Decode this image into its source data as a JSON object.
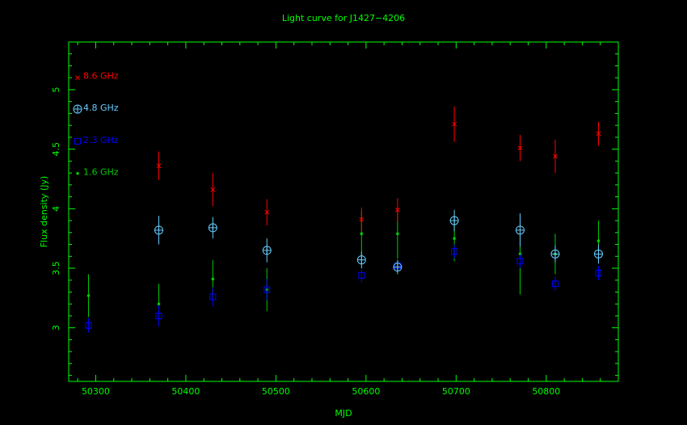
{
  "chart_data": {
    "type": "scatter",
    "title": "Light curve for J1427−4206",
    "xlabel": "MJD",
    "ylabel": "Flux density (Jy)",
    "xlim": [
      50270,
      50880
    ],
    "ylim": [
      2.55,
      5.4
    ],
    "xticks": [
      50300,
      50400,
      50500,
      50600,
      50700,
      50800
    ],
    "yticks": [
      3,
      3.5,
      4,
      4.5,
      5
    ],
    "grid": false,
    "legend_position": "top-left",
    "axis_color": "#00ff00",
    "series": [
      {
        "name": "8.6 GHz",
        "color": "#ff0000",
        "marker": "cross",
        "points": [
          {
            "x": 50370,
            "y": 4.36,
            "err": 0.12
          },
          {
            "x": 50430,
            "y": 4.16,
            "err": 0.14
          },
          {
            "x": 50490,
            "y": 3.97,
            "err": 0.11
          },
          {
            "x": 50595,
            "y": 3.91,
            "err": 0.1
          },
          {
            "x": 50635,
            "y": 3.99,
            "err": 0.1
          },
          {
            "x": 50698,
            "y": 4.71,
            "err": 0.15
          },
          {
            "x": 50771,
            "y": 4.51,
            "err": 0.11
          },
          {
            "x": 50810,
            "y": 4.44,
            "err": 0.14
          },
          {
            "x": 50858,
            "y": 4.63,
            "err": 0.1
          }
        ]
      },
      {
        "name": "4.8 GHz",
        "color": "#66ccff",
        "marker": "circle-plus",
        "points": [
          {
            "x": 50370,
            "y": 3.82,
            "err": 0.12
          },
          {
            "x": 50430,
            "y": 3.84,
            "err": 0.09
          },
          {
            "x": 50490,
            "y": 3.65,
            "err": 0.1
          },
          {
            "x": 50595,
            "y": 3.57,
            "err": 0.07
          },
          {
            "x": 50635,
            "y": 3.51,
            "err": 0.06
          },
          {
            "x": 50698,
            "y": 3.9,
            "err": 0.09
          },
          {
            "x": 50771,
            "y": 3.82,
            "err": 0.14
          },
          {
            "x": 50810,
            "y": 3.62,
            "err": 0.07
          },
          {
            "x": 50858,
            "y": 3.62,
            "err": 0.08
          }
        ]
      },
      {
        "name": "2.3 GHz",
        "color": "#0000ff",
        "marker": "square",
        "points": [
          {
            "x": 50292,
            "y": 3.02,
            "err": 0.06
          },
          {
            "x": 50370,
            "y": 3.1,
            "err": 0.09
          },
          {
            "x": 50430,
            "y": 3.26,
            "err": 0.08
          },
          {
            "x": 50490,
            "y": 3.32,
            "err": 0.09
          },
          {
            "x": 50595,
            "y": 3.44,
            "err": 0.06
          },
          {
            "x": 50635,
            "y": 3.52,
            "err": 0.05
          },
          {
            "x": 50698,
            "y": 3.64,
            "err": 0.06
          },
          {
            "x": 50771,
            "y": 3.56,
            "err": 0.06
          },
          {
            "x": 50810,
            "y": 3.37,
            "err": 0.06
          },
          {
            "x": 50858,
            "y": 3.46,
            "err": 0.06
          }
        ]
      },
      {
        "name": "1.6 GHz",
        "color": "#00cc00",
        "marker": "dot",
        "points": [
          {
            "x": 50292,
            "y": 3.27,
            "err": 0.18
          },
          {
            "x": 50370,
            "y": 3.2,
            "err": 0.17
          },
          {
            "x": 50430,
            "y": 3.41,
            "err": 0.16
          },
          {
            "x": 50490,
            "y": 3.32,
            "err": 0.18
          },
          {
            "x": 50595,
            "y": 3.79,
            "err": 0.19
          },
          {
            "x": 50635,
            "y": 3.79,
            "err": 0.21
          },
          {
            "x": 50698,
            "y": 3.75,
            "err": 0.19
          },
          {
            "x": 50771,
            "y": 3.62,
            "err": 0.34
          },
          {
            "x": 50810,
            "y": 3.62,
            "err": 0.17
          },
          {
            "x": 50858,
            "y": 3.73,
            "err": 0.17
          }
        ]
      }
    ]
  }
}
